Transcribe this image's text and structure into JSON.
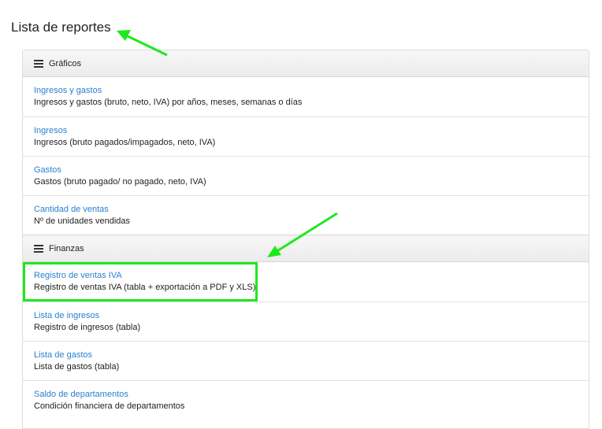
{
  "page_title": "Lista de reportes",
  "sections": [
    {
      "title": "Gráficos",
      "items": [
        {
          "link": "Ingresos y gastos",
          "desc": "Ingresos y gastos (bruto, neto, IVA) por años, meses, semanas o días"
        },
        {
          "link": "Ingresos",
          "desc": "Ingresos (bruto pagados/impagados, neto, IVA)"
        },
        {
          "link": "Gastos",
          "desc": "Gastos (bruto pagado/ no pagado, neto, IVA)"
        },
        {
          "link": "Cantidad de ventas",
          "desc": "Nº de unidades vendidas"
        }
      ]
    },
    {
      "title": "Finanzas",
      "items": [
        {
          "link": "Registro de ventas IVA",
          "desc": "Registro de ventas IVA (tabla + exportación a PDF y XLS)"
        },
        {
          "link": "Lista de ingresos",
          "desc": "Registro de ingresos (tabla)"
        },
        {
          "link": "Lista de gastos",
          "desc": "Lista de gastos (tabla)"
        },
        {
          "link": "Saldo de departamentos",
          "desc": "Condición financiera de departamentos"
        }
      ]
    }
  ],
  "colors": {
    "link": "#2a7fd0",
    "annotation": "#1de91d"
  }
}
